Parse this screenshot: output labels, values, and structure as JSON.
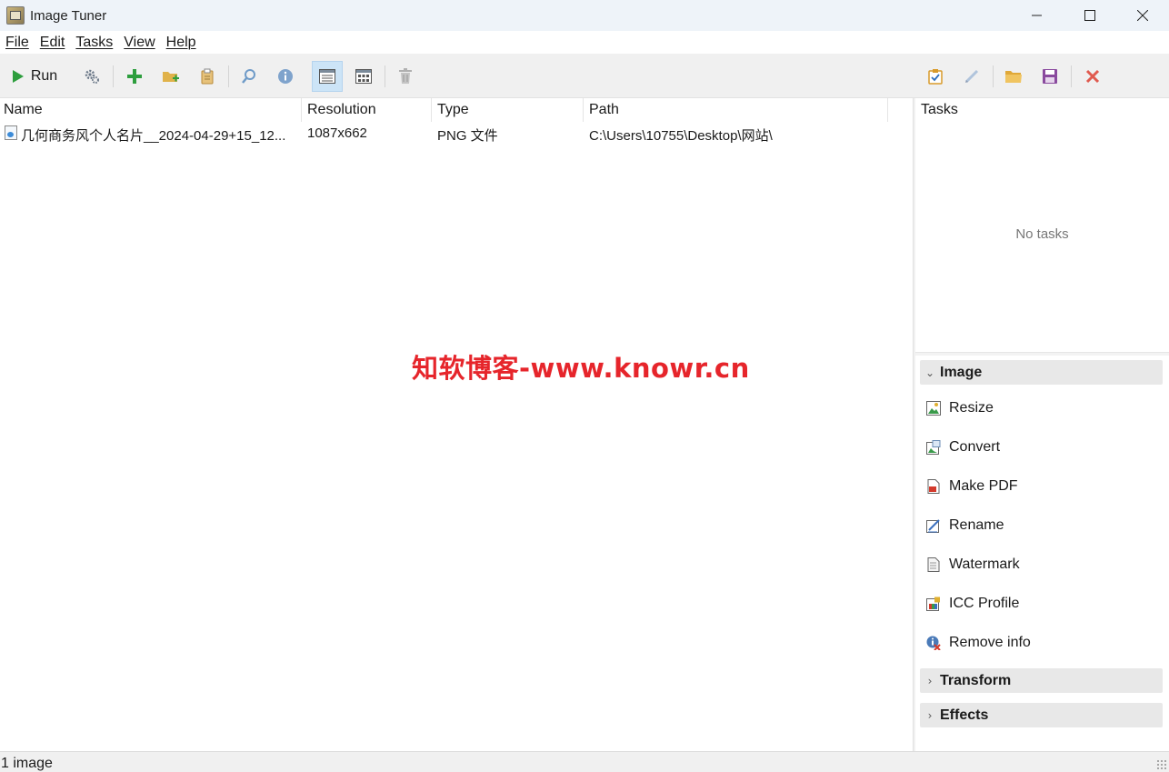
{
  "window": {
    "title": "Image Tuner",
    "controls": {
      "minimize": "—",
      "maximize": "☐",
      "close": "✕"
    }
  },
  "menu": [
    "File",
    "Edit",
    "Tasks",
    "View",
    "Help"
  ],
  "toolbar": {
    "run_label": "Run",
    "left_icons": [
      "settings-icon",
      "add-icon",
      "add-folder-icon",
      "paste-icon",
      "search-icon",
      "info-icon",
      "details-view-icon",
      "thumbnail-view-icon",
      "delete-icon"
    ],
    "right_icons": [
      "task-list-icon",
      "edit-icon",
      "open-folder-icon",
      "save-icon",
      "clear-icon"
    ],
    "active": "details-view-icon"
  },
  "file_list": {
    "columns": [
      "Name",
      "Resolution",
      "Type",
      "Path"
    ],
    "rows": [
      {
        "name": "几何商务风个人名片__2024-04-29+15_12...",
        "resolution": "1087x662",
        "type": "PNG 文件",
        "path": "C:\\Users\\10755\\Desktop\\网站\\"
      }
    ]
  },
  "watermark": "知软博客-www.knowr.cn",
  "tasks_panel": {
    "title": "Tasks",
    "empty_text": "No tasks"
  },
  "actions": {
    "groups": [
      {
        "label": "Image",
        "expanded": true,
        "items": [
          {
            "label": "Resize",
            "icon": "resize-icon"
          },
          {
            "label": "Convert",
            "icon": "convert-icon"
          },
          {
            "label": "Make PDF",
            "icon": "pdf-icon"
          },
          {
            "label": "Rename",
            "icon": "rename-icon"
          },
          {
            "label": "Watermark",
            "icon": "watermark-icon"
          },
          {
            "label": "ICC Profile",
            "icon": "icc-profile-icon"
          },
          {
            "label": "Remove info",
            "icon": "remove-info-icon"
          }
        ]
      },
      {
        "label": "Transform",
        "expanded": false
      },
      {
        "label": "Effects",
        "expanded": false
      }
    ]
  },
  "status": {
    "text": "1 image"
  },
  "colors": {
    "titlebar_bg": "#eef3f9",
    "toolbar_bg": "#f0f0f0",
    "watermark": "#e6252b",
    "active_button": "#cce4f7",
    "run_green": "#2e9e3e",
    "delete_red": "#e05a4f"
  }
}
